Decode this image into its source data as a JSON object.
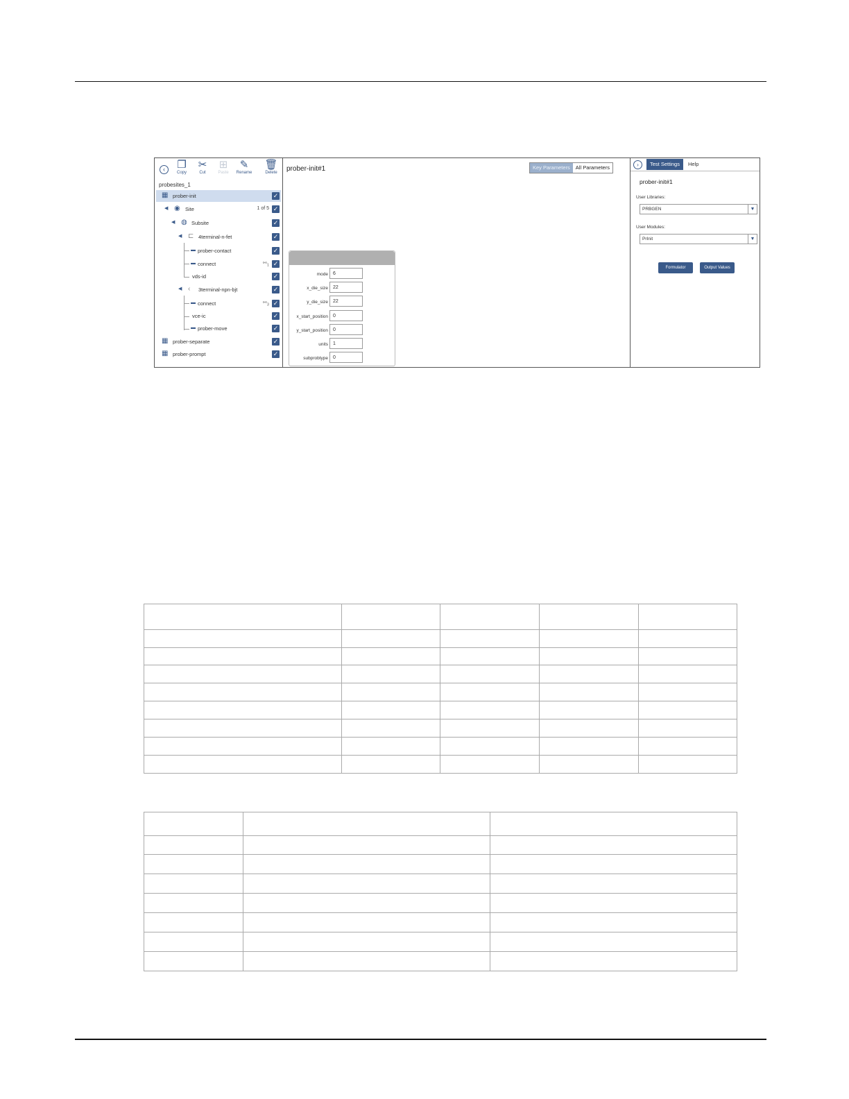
{
  "toolbar": {
    "copy": "Copy",
    "cut": "Cut",
    "paste": "Paste",
    "rename": "Rename",
    "delete": "Delete"
  },
  "project": {
    "name": "probesites_1"
  },
  "tree": {
    "prober_init": "prober-init",
    "site": "Site",
    "site_count": "1 of 5",
    "subsite": "Subsite",
    "device1": "4terminal-n-fet",
    "prober_contact": "prober-contact",
    "connect1": "connect",
    "connect1_badge": "1",
    "vds_id": "vds-id",
    "device2": "3terminal-npn-bjt",
    "connect2": "connect",
    "connect2_badge": "3",
    "vce_ic": "vce-ic",
    "prober_move": "prober-move",
    "prober_separate": "prober-separate",
    "prober_prompt": "prober-prompt"
  },
  "main": {
    "title": "prober-init#1",
    "tab_key": "Key Parameters",
    "tab_all": "All Parameters",
    "params": [
      {
        "label": "mode",
        "value": "6"
      },
      {
        "label": "x_die_size",
        "value": "22"
      },
      {
        "label": "y_die_size",
        "value": "22"
      },
      {
        "label": "x_start_position",
        "value": "0"
      },
      {
        "label": "y_start_position",
        "value": "0"
      },
      {
        "label": "units",
        "value": "1"
      },
      {
        "label": "subprobtype",
        "value": "0"
      }
    ]
  },
  "right": {
    "tab_settings": "Test Settings",
    "tab_help": "Help",
    "name": "prober-init#1",
    "libraries_label": "User Libraries:",
    "libraries_value": "PRBGEN",
    "modules_label": "User Modules:",
    "modules_value": "PrInit",
    "formulator": "Formulator",
    "output_values": "Output Values"
  },
  "icons": {
    "back": "chevron-left-icon",
    "copy": "copy-icon",
    "cut": "scissors-icon",
    "paste": "paste-icon",
    "rename": "pencil-icon",
    "delete": "trash-icon"
  },
  "colors": {
    "accent": "#3a5a8a",
    "selection": "#cfdcee",
    "card_header": "#b0b0b0"
  }
}
